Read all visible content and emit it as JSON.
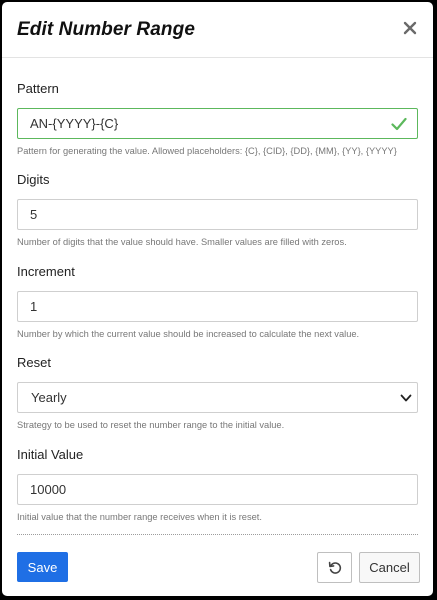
{
  "dialog": {
    "title": "Edit Number Range"
  },
  "fields": {
    "pattern": {
      "label": "Pattern",
      "value": "AN-{YYYY}-{C}",
      "help": "Pattern for generating the value. Allowed placeholders: {C}, {CID}, {DD}, {MM}, {YY}, {YYYY}",
      "valid": true
    },
    "digits": {
      "label": "Digits",
      "value": "5",
      "help": "Number of digits that the value should have. Smaller values are filled with zeros."
    },
    "increment": {
      "label": "Increment",
      "value": "1",
      "help": "Number by which the current value should be increased to calculate the next value."
    },
    "reset": {
      "label": "Reset",
      "value": "Yearly",
      "help": "Strategy to be used to reset the number range to the initial value."
    },
    "initial_value": {
      "label": "Initial Value",
      "value": "10000",
      "help": "Initial value that the number range receives when it is reset."
    }
  },
  "footer": {
    "save_label": "Save",
    "cancel_label": "Cancel"
  },
  "icons": {
    "close": "close-icon",
    "check": "check-icon",
    "chevron": "chevron-down-icon",
    "reset": "reset-icon"
  },
  "colors": {
    "primary": "#1f6fe5",
    "valid": "#5cb85c",
    "backdrop": "#000000"
  }
}
